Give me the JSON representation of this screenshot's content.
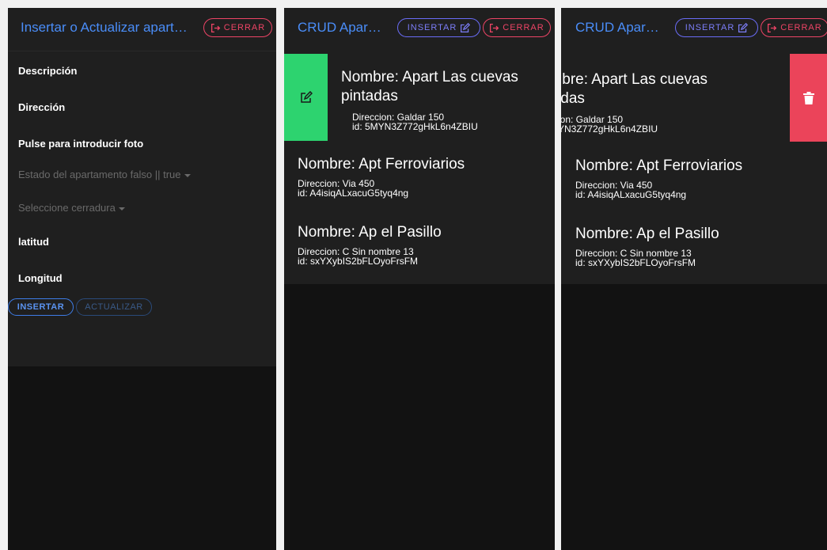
{
  "form_panel": {
    "title": "Insertar o Actualizar apart…",
    "close_label": "CERRAR",
    "fields": {
      "descripcion": "Descripción",
      "direccion": "Dirección",
      "foto": "Pulse para introducir foto",
      "estado": "Estado del apartamento falso || true",
      "cerradura": "Seleccione cerradura",
      "latitud": "latitud",
      "longitud": "Longitud"
    },
    "insert_label": "INSERTAR",
    "update_label": "ACTUALIZAR"
  },
  "list_panel": {
    "title": "CRUD Apar…",
    "insert_label": "INSERTAR",
    "close_label": "CERRAR",
    "items": [
      {
        "name_line1": "Nombre: Apart Las cuevas",
        "name_line2": "pintadas",
        "direccion": "Direccion: Galdar 150",
        "id": "id: 5MYN3Z772gHkL6n4ZBIU"
      },
      {
        "name": "Nombre: Apt Ferroviarios",
        "direccion": "Direccion: Via 450",
        "id": "id: A4isiqALxacuG5tyq4ng"
      },
      {
        "name": "Nombre: Ap el Pasillo",
        "direccion": "Direccion: C Sin nombre 13",
        "id": "id: sxYXybIS2bFLOyoFrsFM"
      }
    ]
  },
  "list_panel_2": {
    "title": "CRUD Apar…",
    "insert_label": "INSERTAR",
    "close_label": "CERRAR",
    "items": [
      {
        "name_line1": "ıbre: Apart Las cuevas",
        "name_line2": "ıdas",
        "direccion": "ion: Galdar 150",
        "id": "YN3Z772gHkL6n4ZBIU"
      },
      {
        "name": "Nombre: Apt Ferroviarios",
        "direccion": "Direccion: Via 450",
        "id": "id: A4isiqALxacuG5tyq4ng"
      },
      {
        "name": "Nombre: Ap el Pasillo",
        "direccion": "Direccion: C Sin nombre 13",
        "id": "id: sxYXybIS2bFLOyoFrsFM"
      }
    ]
  },
  "colors": {
    "primary": "#4a8df8",
    "danger": "#eb445a",
    "success": "#2dd36f",
    "secondary": "#6a6cf6"
  },
  "icons": {
    "close": "exit-icon",
    "edit": "edit-icon",
    "delete": "trash-icon"
  }
}
